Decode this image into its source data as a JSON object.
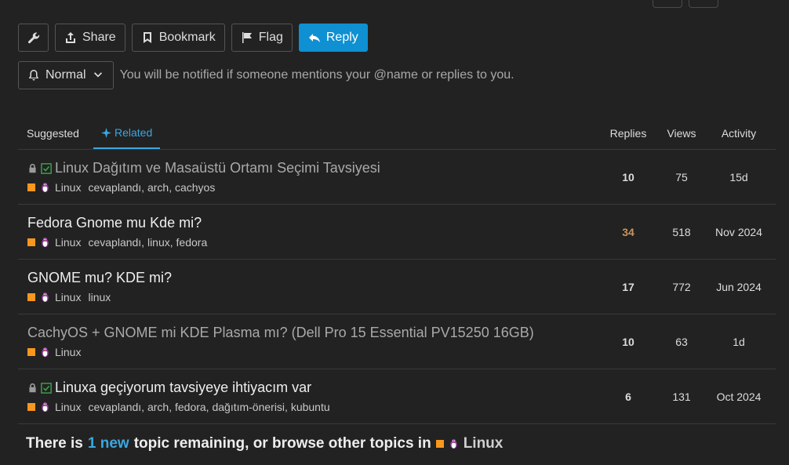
{
  "toolbar": {
    "share_label": "Share",
    "bookmark_label": "Bookmark",
    "flag_label": "Flag",
    "reply_label": "Reply"
  },
  "notification": {
    "level": "Normal",
    "description": "You will be notified if someone mentions your @name or replies to you."
  },
  "tabs": {
    "suggested": "Suggested",
    "related": "Related"
  },
  "columns": {
    "replies": "Replies",
    "views": "Views",
    "activity": "Activity"
  },
  "topics": [
    {
      "title": "Linux Dağıtım ve Masaüstü Ortamı Seçimi Tavsiyesi",
      "category": "Linux",
      "tags": "cevaplandı, arch, cachyos",
      "replies": "10",
      "views": "75",
      "activity": "15d"
    },
    {
      "title": "Fedora Gnome mu Kde mi?",
      "category": "Linux",
      "tags": "cevaplandı, linux, fedora",
      "replies": "34",
      "views": "518",
      "activity": "Nov 2024"
    },
    {
      "title": "GNOME mu? KDE mi?",
      "category": "Linux",
      "tags": "linux",
      "replies": "17",
      "views": "772",
      "activity": "Jun 2024"
    },
    {
      "title": "CachyOS + GNOME mi KDE Plasma mı? (Dell Pro 15 Essential PV15250 16GB)",
      "category": "Linux",
      "tags": "",
      "replies": "10",
      "views": "63",
      "activity": "1d"
    },
    {
      "title": "Linuxa geçiyorum tavsiyeye ihtiyacım var",
      "category": "Linux",
      "tags": "cevaplandı, arch, fedora, dağıtım-önerisi, kubuntu",
      "replies": "6",
      "views": "131",
      "activity": "Oct 2024"
    }
  ],
  "footer": {
    "prefix": "There is",
    "new_link": "1 new",
    "middle": "topic remaining, or browse other topics in",
    "category": "Linux"
  },
  "colors": {
    "accent": "#0e90d2",
    "category": "#f8961e",
    "hot_replies": "#c8955c",
    "solved_check": "#3fa34d"
  }
}
